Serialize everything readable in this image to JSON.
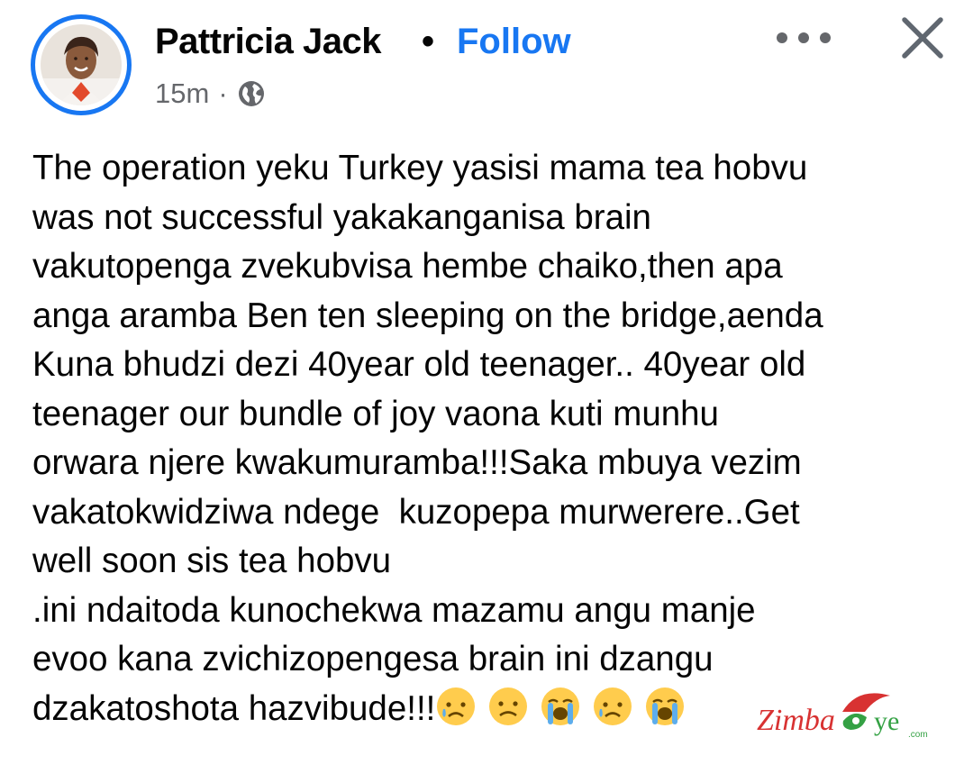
{
  "author": {
    "name": "Pattricia Jack",
    "avatar_icon": "profile-photo"
  },
  "header": {
    "separator": "•",
    "follow_label": "Follow",
    "timestamp": "15m",
    "meta_separator": "·",
    "privacy_icon": "globe-icon",
    "more_icon": "more-options-icon",
    "close_icon": "close-icon"
  },
  "post": {
    "body": "The operation yeku Turkey yasisi mama tea hobvu\nwas not successful yakakanganisa brain\nvakutopenga zvekubvisa hembe chaiko,then apa\nanga aramba Ben ten sleeping on the bridge,aenda\nKuna bhudzi dezi 40year old teenager.. 40year old\nteenager our bundle of joy vaona kuti munhu\norwara njere kwakumuramba!!!Saka mbuya vezim\nvakatokwidziwa ndege  kuzopepa murwerere..Get\nwell soon sis tea hobvu\n.ini ndaitoda kunochekwa mazamu angu manje\nevoo kana zvichizopengesa brain ini dzangu\ndzakatoshota hazvibude!!!",
    "emojis": [
      "sad-tear-emoji",
      "frown-emoji",
      "loudly-crying-emoji",
      "sad-tear-emoji",
      "loudly-crying-emoji"
    ]
  },
  "watermark": {
    "text": "ZimbaEye",
    "suffix": ".com"
  },
  "colors": {
    "accent": "#1877f2",
    "secondary_text": "#65676b",
    "text": "#050505"
  }
}
